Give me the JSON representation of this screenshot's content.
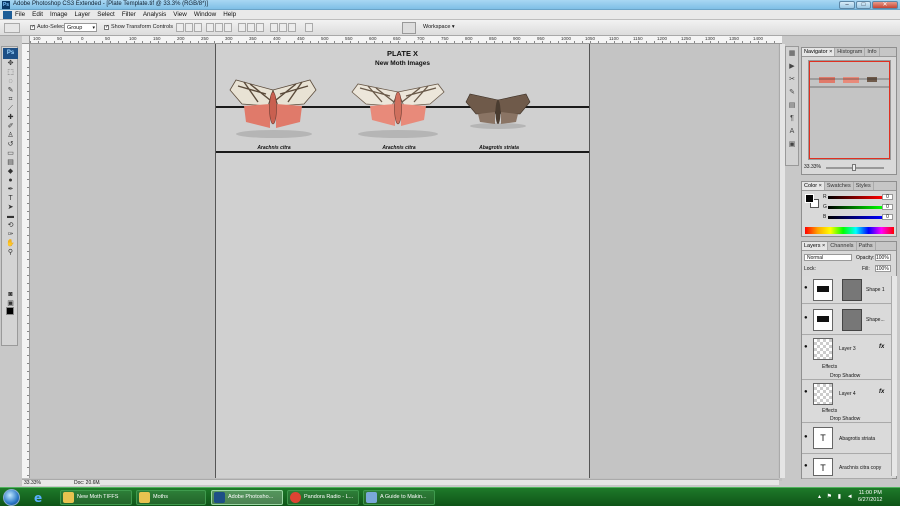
{
  "window": {
    "title": "Adobe Photoshop CS3 Extended - [Plate Template.tif @ 33.3% (RGB/8*)]",
    "controls": [
      "–",
      "□",
      "✕"
    ]
  },
  "menu": [
    "File",
    "Edit",
    "Image",
    "Layer",
    "Select",
    "Filter",
    "Analysis",
    "View",
    "Window",
    "Help"
  ],
  "options": {
    "auto_select_label": "Auto-Select:",
    "auto_select_value": "Group",
    "show_transform_label": "Show Transform Controls",
    "workspace_label": "Workspace ▾"
  },
  "rulers": {
    "h_ticks": [
      "100",
      "50",
      "0",
      "50",
      "100",
      "150",
      "200",
      "250",
      "300",
      "350",
      "400",
      "450",
      "500",
      "550",
      "600",
      "650",
      "700",
      "750",
      "800",
      "850",
      "900",
      "950",
      "1000",
      "1050",
      "1100",
      "1150",
      "1200",
      "1250",
      "1300",
      "1350",
      "1400",
      "1450"
    ]
  },
  "plate": {
    "title": "PLATE X",
    "subtitle": "New Moth Images",
    "moths": [
      {
        "label": "Arachnis citra",
        "wing_color": "#e8e2d4",
        "hind_color": "#e07a6a",
        "pattern": "#5a4a3a"
      },
      {
        "label": "Arachnis citra",
        "wing_color": "#ece6da",
        "hind_color": "#e88a7a",
        "pattern": "#6a5a4a"
      },
      {
        "label": "Abagrotis striata",
        "wing_color": "#6f5a4a",
        "hind_color": "#8a7464",
        "pattern": "#3a2e24"
      }
    ]
  },
  "status": {
    "zoom": "33.33%",
    "doc": "Doc: 20.6M/74.4M"
  },
  "navigator": {
    "tabs": [
      "Navigator ×",
      "Histogram",
      "Info"
    ],
    "zoom": "33.33%"
  },
  "color": {
    "tabs": [
      "Color ×",
      "Swatches",
      "Styles"
    ],
    "channels": [
      {
        "name": "R",
        "value": "0",
        "gradient": "linear-gradient(90deg,#000,#f00)"
      },
      {
        "name": "G",
        "value": "0",
        "gradient": "linear-gradient(90deg,#000,#0f0)"
      },
      {
        "name": "B",
        "value": "0",
        "gradient": "linear-gradient(90deg,#000,#00f)"
      }
    ]
  },
  "layers": {
    "tabs": [
      "Layers ×",
      "Channels",
      "Paths"
    ],
    "blend_mode": "Normal",
    "opacity_label": "Opacity:",
    "opacity": "100%",
    "lock_label": "Lock:",
    "fill_label": "Fill:",
    "fill": "100%",
    "items": [
      {
        "name": "Shape 1",
        "kind": "shape"
      },
      {
        "name": "Shape...",
        "kind": "shape"
      },
      {
        "name": "Layer 3",
        "kind": "raster",
        "fx": "fx",
        "effects": "Effects",
        "shadow": "Drop Shadow"
      },
      {
        "name": "Layer 4",
        "kind": "raster",
        "fx": "fx",
        "effects": "Effects",
        "shadow": "Drop Shadow"
      },
      {
        "name": "Abagrotis striata",
        "kind": "text"
      },
      {
        "name": "Arachnis citra copy",
        "kind": "text"
      }
    ]
  },
  "taskbar": {
    "items": [
      {
        "label": "New Moth TIFFS",
        "color": "#e8c350"
      },
      {
        "label": "Moths",
        "color": "#e8c350"
      },
      {
        "label": "Adobe Photosho...",
        "color": "#1d4f86",
        "active": true
      },
      {
        "label": "Pandora Radio - L...",
        "color": "#dd4433"
      },
      {
        "label": "A Guide to Makin...",
        "color": "#7aa8d8"
      }
    ],
    "time": "11:00 PM",
    "date": "6/27/2012"
  }
}
